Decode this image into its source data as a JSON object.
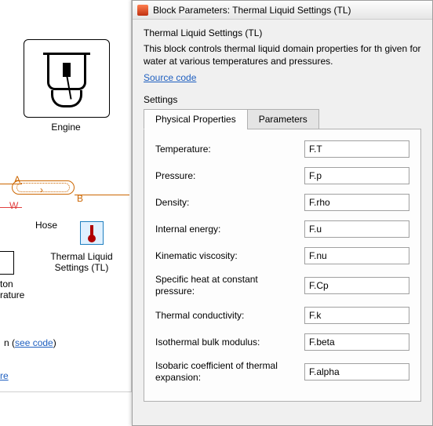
{
  "canvas": {
    "engine_label": "Engine",
    "hose_label": "Hose",
    "port_a": "A",
    "port_b": "B",
    "port_w": "W",
    "tl_label": "Thermal Liquid\nSettings (TL)",
    "ton_label": "ton\nrature",
    "link1_prefix": "n (",
    "link1_text": "see code",
    "link1_suffix": ")",
    "link2_text": "re"
  },
  "dialog": {
    "title": "Block Parameters: Thermal Liquid Settings (TL)",
    "subtitle": "Thermal Liquid Settings (TL)",
    "description": "This block controls thermal liquid domain properties for th given for water at various temperatures and pressures.",
    "source_link": "Source code",
    "settings_label": "Settings",
    "tabs": [
      {
        "label": "Physical Properties"
      },
      {
        "label": "Parameters"
      }
    ],
    "params": [
      {
        "label": "Temperature:",
        "value": "F.T"
      },
      {
        "label": "Pressure:",
        "value": "F.p"
      },
      {
        "label": "Density:",
        "value": "F.rho"
      },
      {
        "label": "Internal energy:",
        "value": "F.u"
      },
      {
        "label": "Kinematic viscosity:",
        "value": "F.nu"
      },
      {
        "label": "Specific heat at constant pressure:",
        "value": "F.Cp"
      },
      {
        "label": "Thermal conductivity:",
        "value": "F.k"
      },
      {
        "label": "Isothermal bulk modulus:",
        "value": "F.beta"
      },
      {
        "label": "Isobaric coefficient of thermal expansion:",
        "value": "F.alpha"
      }
    ]
  }
}
